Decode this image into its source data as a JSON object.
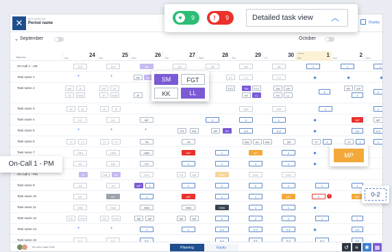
{
  "app": {
    "subtitle": "BTY+40P ICN",
    "title": "Period name",
    "display_label": "Display",
    "months": {
      "left": "September",
      "right": "October"
    }
  },
  "filters": {
    "ok_count": "9",
    "alert_count": "9",
    "view_selected": "Detailed task view",
    "ok_color": "#2dbd75",
    "alert_color": "#e8322b"
  },
  "header": {
    "task_col": "Task list",
    "days": [
      {
        "name": "Sat.",
        "date": "24"
      },
      {
        "name": "Sun.",
        "date": "25"
      },
      {
        "name": "Mon.",
        "date": "26"
      },
      {
        "name": "Tue.",
        "date": "27"
      },
      {
        "name": "Wed.",
        "date": "28"
      },
      {
        "name": "Thu.",
        "date": "29"
      },
      {
        "name": "Fri.",
        "date": "30"
      },
      {
        "name": "Sat.",
        "date": "1",
        "holiday": "Holiday"
      },
      {
        "name": "Sun.",
        "date": "2"
      },
      {
        "name": "Mon.",
        "date": ""
      }
    ]
  },
  "rows": [
    {
      "label": "On-Call 1 - AM"
    },
    {
      "label": "Task name 1"
    },
    {
      "label": "Task name 2"
    },
    {
      "label": "Task name 3"
    },
    {
      "label": "Task name 4"
    },
    {
      "label": "Task name 5"
    },
    {
      "label": "Task name 6"
    },
    {
      "label": "Task name 7"
    },
    {
      "label": "Task name 8"
    },
    {
      "label": "On-Call 1 - PM"
    },
    {
      "label": "Task name 9"
    },
    {
      "label": "Task name 10"
    },
    {
      "label": "Task name 11"
    },
    {
      "label": "Task name 12"
    },
    {
      "label": "Task name 13"
    },
    {
      "label": "Task name 15"
    }
  ],
  "popup": {
    "sm": "SM",
    "fgt": "FGT",
    "kk": "KK",
    "ll": "LL"
  },
  "callouts": {
    "oncall_pm": "On-Call 1 - PM",
    "mp": "MP",
    "range": "0-2"
  },
  "bottom": {
    "users": "You and Juan Cela",
    "tab_planning": "Planning",
    "tab_equity": "Equity"
  }
}
